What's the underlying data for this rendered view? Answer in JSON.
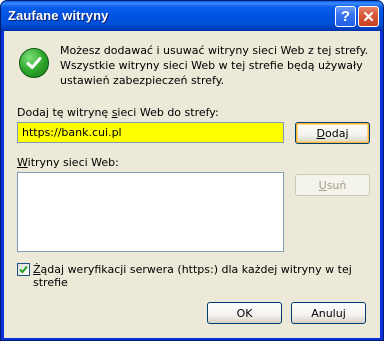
{
  "window": {
    "title": "Zaufane witryny",
    "help_label": "?",
    "close_label": "✕"
  },
  "info": {
    "icon": "check-icon",
    "line1": "Możesz dodawać i usuwać witryny sieci Web z tej strefy.",
    "line2": "Wszystkie witryny sieci Web w tej strefie będą używały",
    "line3": "ustawień zabezpieczeń strefy."
  },
  "add_site": {
    "label_pre": "Dodaj tę witrynę ",
    "label_key": "s",
    "label_post": "ieci Web do strefy:",
    "value": "https://bank.cui.pl",
    "button_key": "D",
    "button_rest": "odaj"
  },
  "sites": {
    "label_key": "W",
    "label_rest": "itryny sieci Web:",
    "items": [],
    "remove_key": "U",
    "remove_rest": "suń"
  },
  "verify": {
    "checked": true,
    "label_key": "Ż",
    "label_rest": "ądaj weryfikacji serwera (https:) dla każdej witryny w tej strefie"
  },
  "buttons": {
    "ok": "OK",
    "cancel": "Anuluj"
  },
  "colors": {
    "titlebar": "#0054e3",
    "input_highlight": "#ffff00",
    "dialog_bg": "#ece9d8"
  }
}
